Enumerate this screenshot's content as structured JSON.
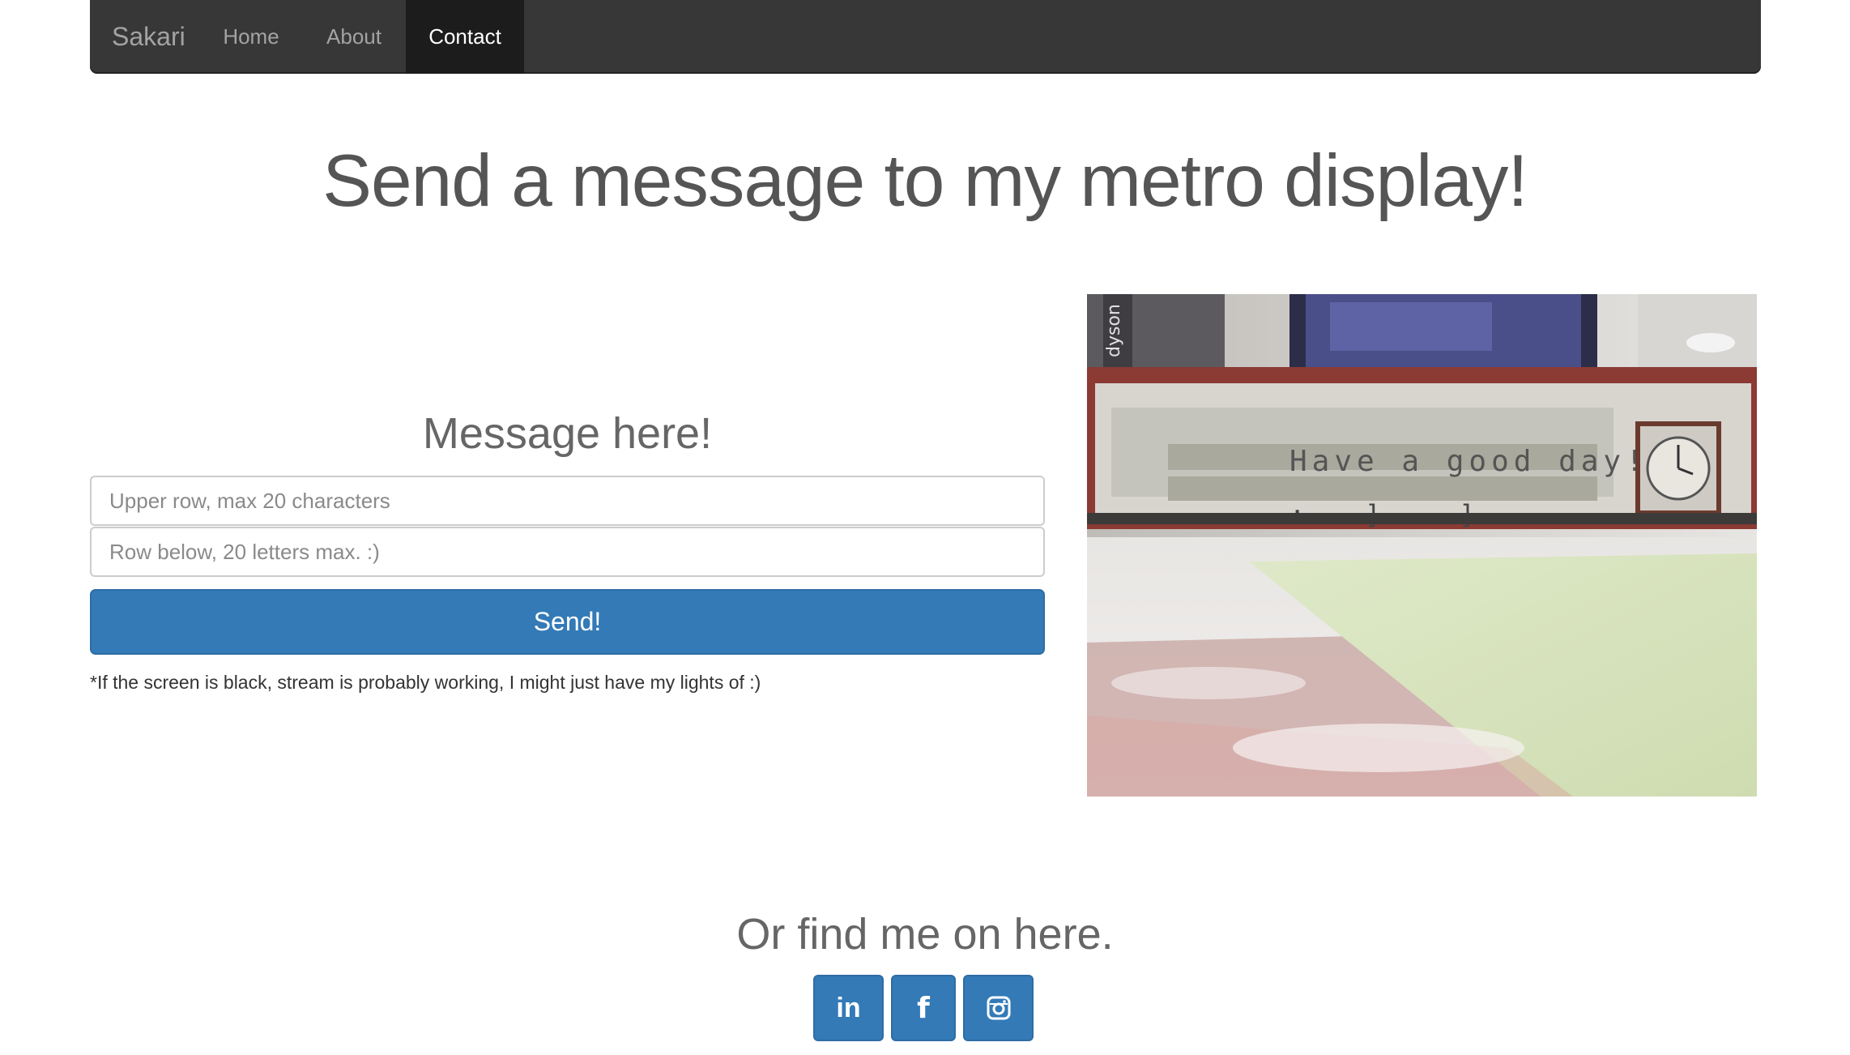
{
  "navbar": {
    "brand": "Sakari",
    "items": [
      {
        "label": "Home"
      },
      {
        "label": "About"
      },
      {
        "label": "Contact",
        "active": true
      }
    ]
  },
  "page_title": "Send a message to my metro display!",
  "form": {
    "title": "Message here!",
    "upper_placeholder": "Upper row, max 20 characters",
    "lower_placeholder": "Row below, 20 letters max. :)",
    "upper_value": "",
    "lower_value": "",
    "send_label": "Send!",
    "note": "*If the screen is black, stream is probably working, I might just have my lights of :)"
  },
  "stream": {
    "display_row1": "Have a good day!!",
    "display_row2": ":---]  ---]",
    "device_label": "dyson"
  },
  "social": {
    "title": "Or find me on here.",
    "buttons": [
      {
        "icon": "linkedin-icon",
        "text": "in"
      },
      {
        "icon": "facebook-icon",
        "text": "f"
      },
      {
        "icon": "instagram-icon"
      }
    ]
  },
  "colors": {
    "navbar_bg": "#373737",
    "nav_active_bg": "#1c1c1c",
    "primary": "#337ab7",
    "heading": "#555555"
  }
}
